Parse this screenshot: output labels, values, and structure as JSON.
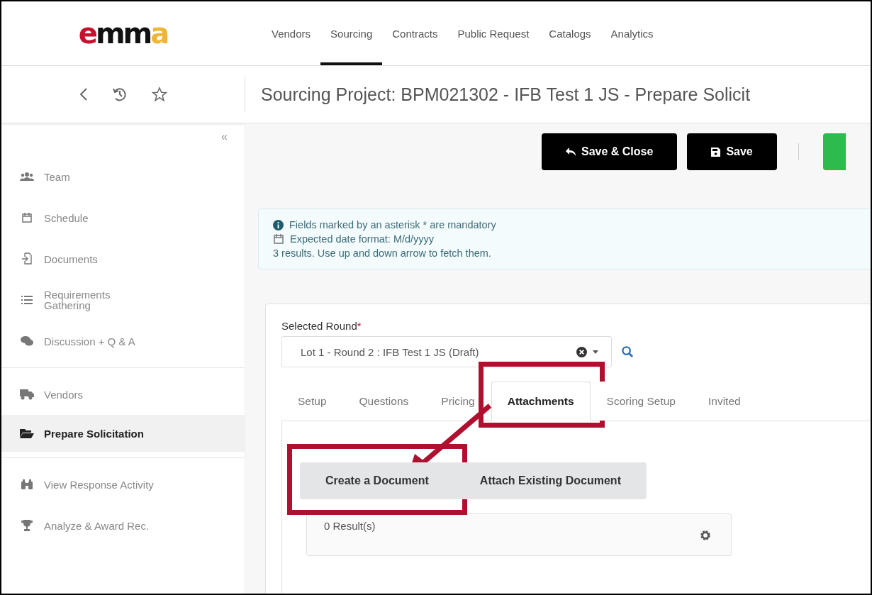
{
  "logo": {
    "parts": [
      {
        "text": "e",
        "color": "#c8102e"
      },
      {
        "text": "mm",
        "color": "#111111"
      },
      {
        "text": "a",
        "color": "#f0b536"
      }
    ]
  },
  "nav": [
    {
      "label": "Vendors",
      "selected": false
    },
    {
      "label": "Sourcing",
      "selected": true
    },
    {
      "label": "Contracts",
      "selected": false
    },
    {
      "label": "Public Request",
      "selected": false
    },
    {
      "label": "Catalogs",
      "selected": false
    },
    {
      "label": "Analytics",
      "selected": false
    }
  ],
  "page_title": "Sourcing Project: BPM021302 - IFB Test 1 JS - Prepare Solicit",
  "collapse": "«",
  "sidebar": {
    "groups": [
      {
        "items": [
          {
            "label": "Team",
            "kind": "team",
            "selected": false
          },
          {
            "label": "Schedule",
            "kind": "calendar",
            "selected": false
          },
          {
            "label": "Documents",
            "kind": "document",
            "selected": false
          },
          {
            "label": "Requirements Gathering",
            "kind": "list",
            "selected": false
          },
          {
            "label": "Discussion + Q & A",
            "kind": "chat",
            "selected": false
          }
        ]
      },
      {
        "items": [
          {
            "label": "Vendors",
            "kind": "truck",
            "selected": false
          },
          {
            "label": "Prepare Solicitation",
            "kind": "folder",
            "selected": true
          }
        ]
      },
      {
        "items": [
          {
            "label": "View Response Activity",
            "kind": "binoculars",
            "selected": false
          },
          {
            "label": "Analyze & Award Rec.",
            "kind": "trophy",
            "selected": false
          }
        ]
      }
    ]
  },
  "toolbar": {
    "buttons": [
      {
        "label": "Save & Close",
        "kind": "reply"
      },
      {
        "label": "Save",
        "kind": "disk"
      }
    ]
  },
  "info": {
    "lines": [
      {
        "kind": "info",
        "text": "Fields marked by an asterisk * are mandatory"
      },
      {
        "kind": "calendar",
        "text": "Expected date format: M/d/yyyy"
      },
      {
        "kind": "plain",
        "text": "3 results. Use up and down arrow to fetch them."
      }
    ]
  },
  "selected_round": {
    "label": "Selected Round",
    "required": "*",
    "value": "Lot 1 - Round 2 : IFB Test 1 JS (Draft)"
  },
  "tabs": [
    {
      "label": "Setup",
      "selected": false
    },
    {
      "label": "Questions",
      "selected": false
    },
    {
      "label": "Pricing",
      "selected": false
    },
    {
      "label": "Attachments",
      "selected": true
    },
    {
      "label": "Scoring Setup",
      "selected": false
    },
    {
      "label": "Invited",
      "selected": false
    }
  ],
  "actions": [
    {
      "label": "Create a Document"
    },
    {
      "label": "Attach Existing Document"
    }
  ],
  "results": {
    "count": "0 Result(s)"
  }
}
